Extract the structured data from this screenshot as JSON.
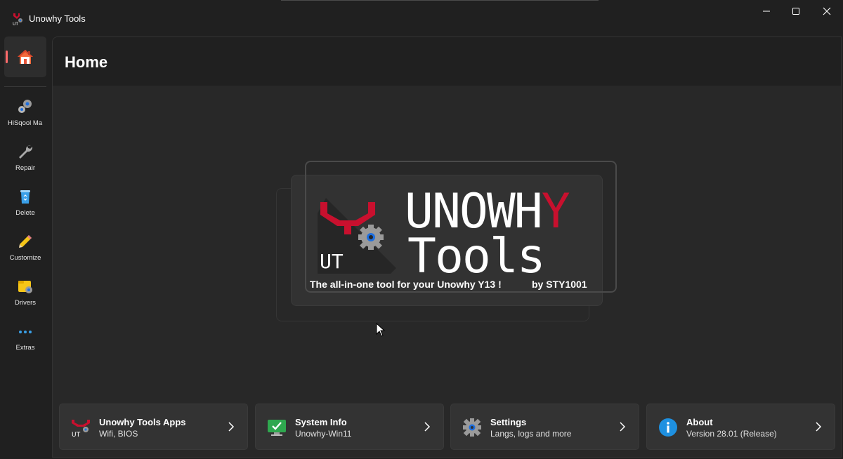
{
  "window": {
    "title": "Unowhy Tools",
    "app_icon": "unowhy-tools-logo-icon",
    "caption_buttons": [
      "minimize-icon",
      "maximize-icon",
      "close-icon"
    ]
  },
  "nav": {
    "home": {
      "icon": "home-icon",
      "selected": true,
      "indicator_color": "#ff6b6b"
    },
    "items": [
      {
        "label": "HiSqool Ma",
        "icon": "gears-icon"
      },
      {
        "label": "Repair",
        "icon": "wrench-icon"
      },
      {
        "label": "Delete",
        "icon": "recycle-bin-icon"
      },
      {
        "label": "Customize",
        "icon": "pencil-icon"
      },
      {
        "label": "Drivers",
        "icon": "folder-gear-icon"
      },
      {
        "label": "Extras",
        "icon": "more-dots-icon"
      }
    ]
  },
  "page": {
    "title": "Home"
  },
  "banner": {
    "logo_text": "UT",
    "word_line1_a": "UNOWH",
    "word_line1_b": "Y",
    "word_line2": "Tools",
    "tagline": "The all-in-one tool for your Unowhy Y13 !",
    "by": "by STY1001",
    "accent_color": "#c8102e"
  },
  "cards": [
    {
      "title": "Unowhy Tools Apps",
      "subtitle": "Wifi, BIOS",
      "icon": "unowhy-tools-logo-icon"
    },
    {
      "title": "System Info",
      "subtitle": "Unowhy-Win11",
      "icon": "monitor-check-icon"
    },
    {
      "title": "Settings",
      "subtitle": "Langs, logs and more",
      "icon": "settings-gear-icon"
    },
    {
      "title": "About",
      "subtitle": "Version 28.01 (Release)",
      "icon": "info-icon"
    }
  ],
  "colors": {
    "background": "#202020",
    "surface": "#282828",
    "card": "#333333",
    "accent": "#c8102e",
    "info_blue": "#1e90e0"
  }
}
